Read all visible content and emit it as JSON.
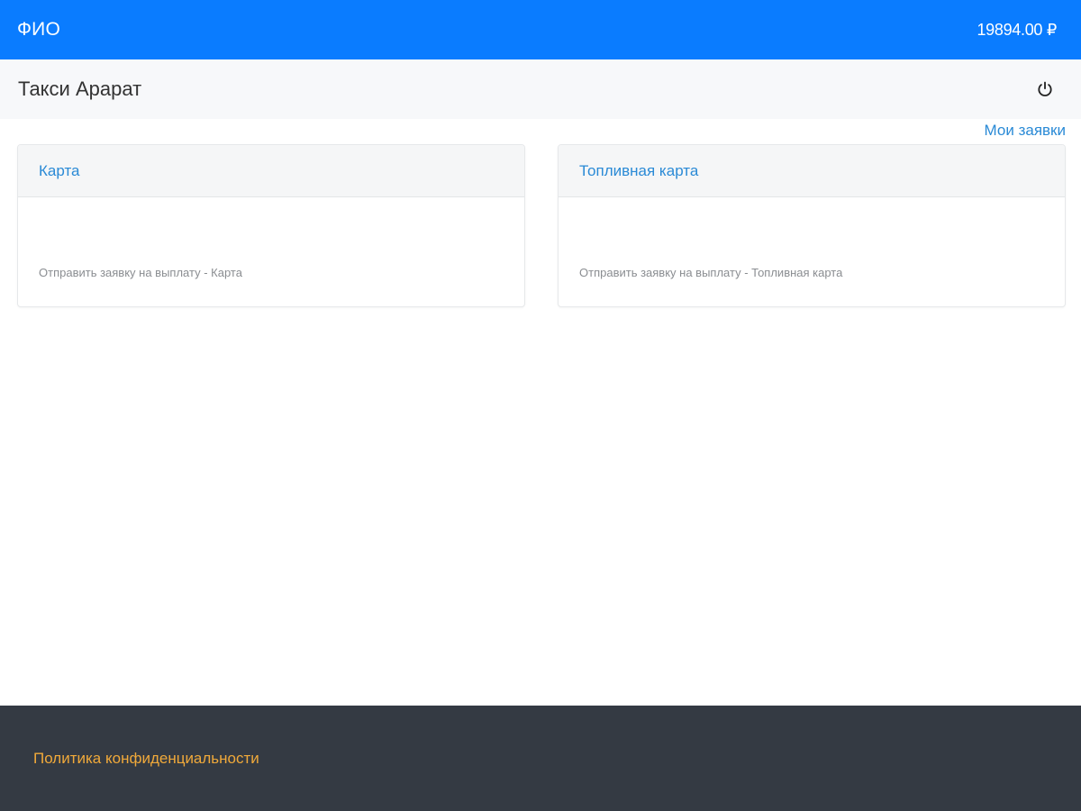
{
  "header": {
    "user_name": "ФИО",
    "balance": "19894.00 ₽"
  },
  "subheader": {
    "company_name": "Такси Арарат",
    "power_icon": "power-icon"
  },
  "links": {
    "my_requests": "Мои заявки"
  },
  "cards": [
    {
      "title": "Карта",
      "description": "Отправить заявку на выплату - Карта"
    },
    {
      "title": "Топливная карта",
      "description": "Отправить заявку на выплату - Топливная карта"
    }
  ],
  "footer": {
    "privacy_link": "Политика конфиденциальности"
  },
  "colors": {
    "header_bg": "#0a7cff",
    "link_blue": "#2a8ad6",
    "footer_bg": "#343a43",
    "footer_link": "#f0a93a"
  }
}
